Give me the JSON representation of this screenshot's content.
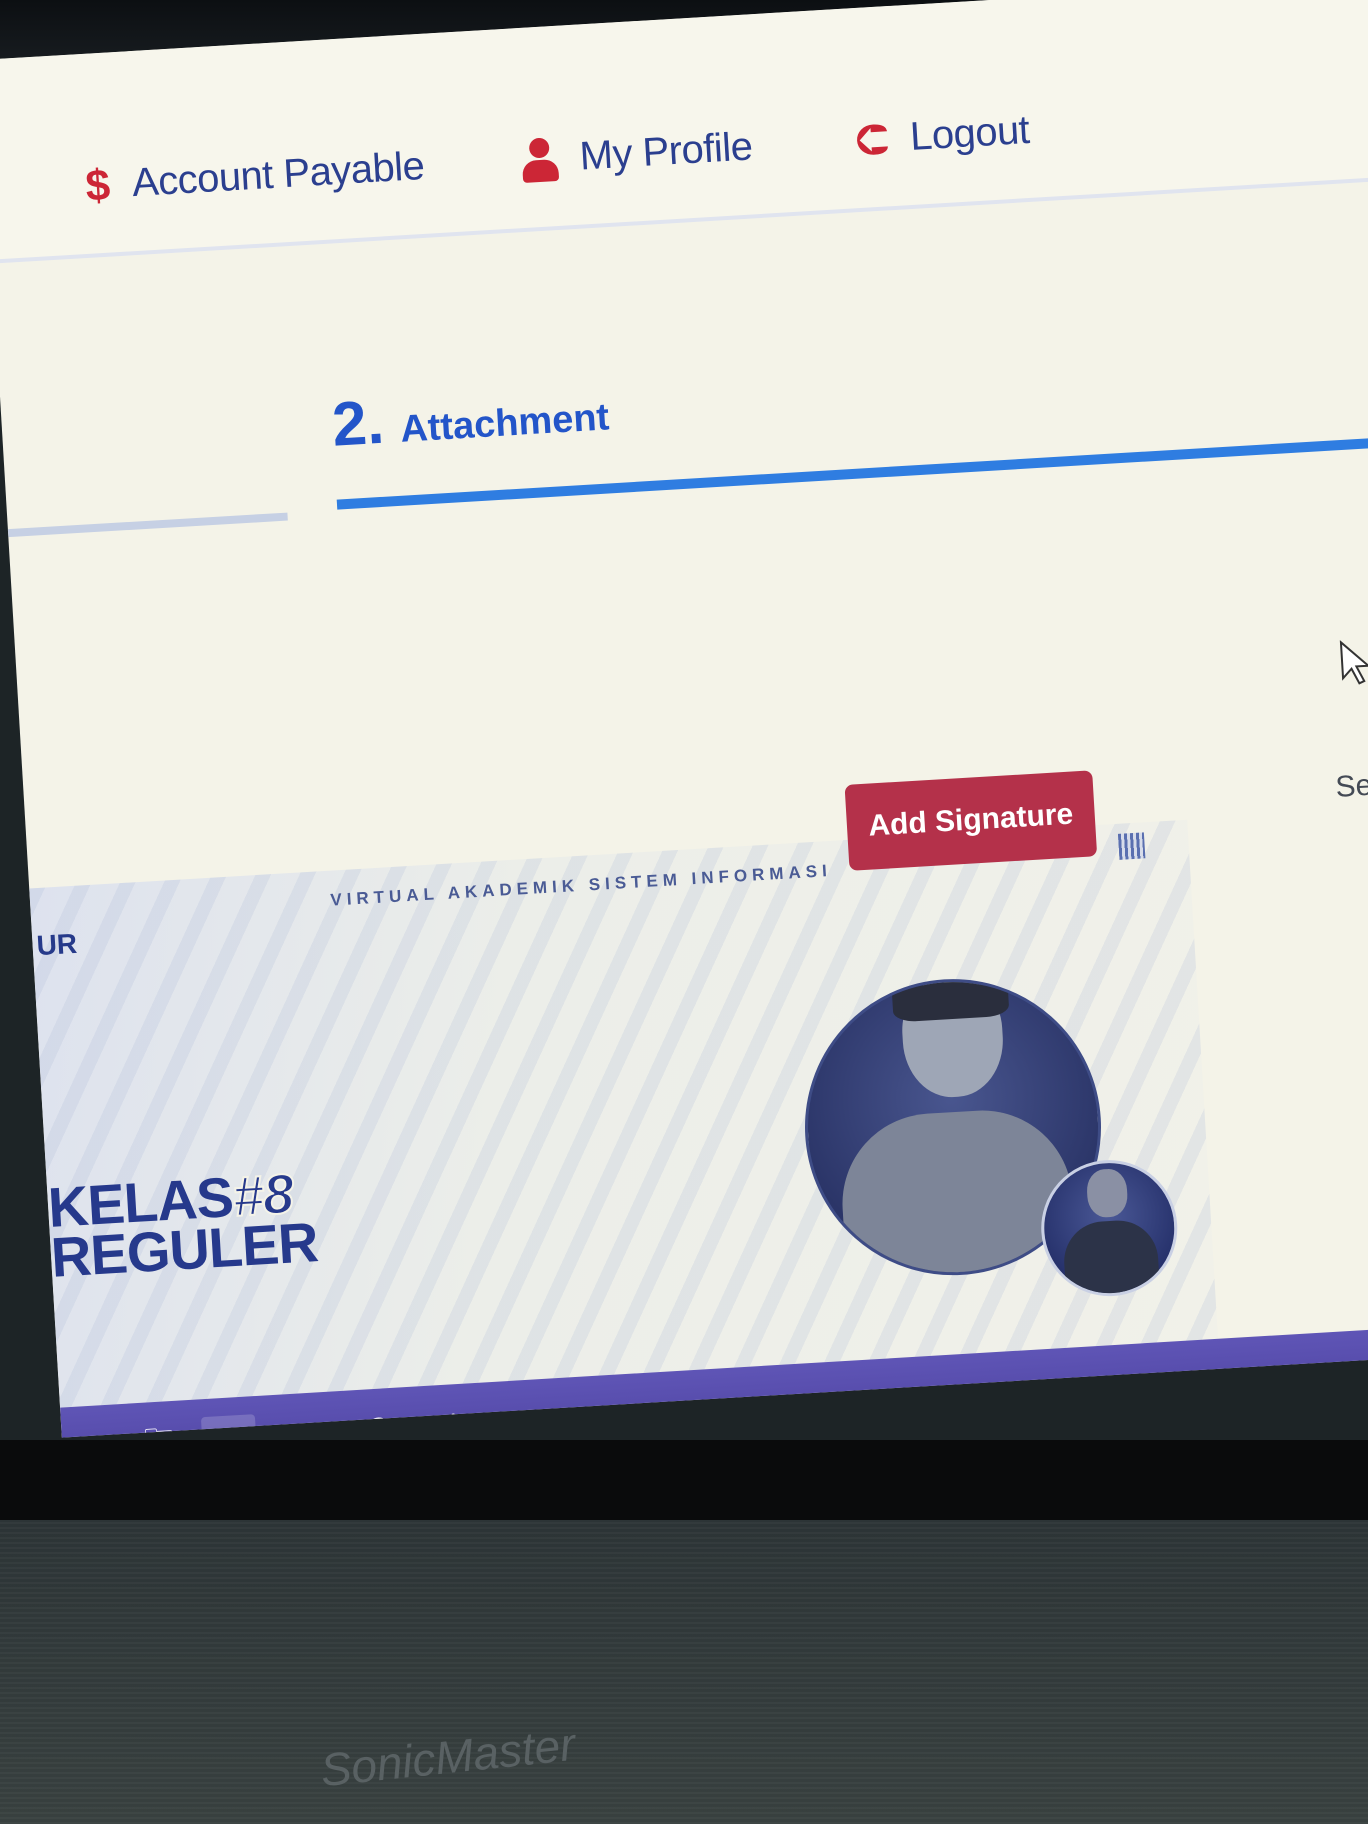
{
  "nav": {
    "account_payable": {
      "icon": "dollar-icon",
      "glyph": "$",
      "label": "Account Payable"
    },
    "my_profile": {
      "icon": "user-icon",
      "label": "My Profile"
    },
    "logout": {
      "icon": "logout-icon",
      "glyph": "⮈",
      "label": "Logout"
    }
  },
  "step": {
    "number": "2.",
    "label": "Attachment"
  },
  "sender_label": "Sender",
  "attachment": {
    "caption": "VIRTUAL AKADEMIK SISTEM INFORMASI",
    "corner_text": "UR",
    "title_line1": "KELAS",
    "title_hash": "#8",
    "title_line2": "REGULER"
  },
  "add_signature_label": "Add Signature",
  "taskbar": [
    {
      "name": "file-explorer-icon",
      "glyph": "🗀"
    },
    {
      "name": "chrome-icon",
      "glyph": "◉"
    },
    {
      "name": "notes-icon",
      "glyph": "▤"
    },
    {
      "name": "whatsapp-icon",
      "glyph": "✆"
    },
    {
      "name": "settings-icon",
      "glyph": "⚙"
    },
    {
      "name": "document-icon",
      "glyph": "▯"
    },
    {
      "name": "sticky-notes-icon",
      "glyph": "◧"
    },
    {
      "name": "terminal-icon",
      "glyph": "▭"
    },
    {
      "name": "photos-icon",
      "glyph": "▣"
    },
    {
      "name": "excel-icon",
      "glyph": "▦"
    }
  ],
  "laptop_brand": "SonicMaster",
  "colors": {
    "accent_blue": "#2f7de1",
    "nav_icon_red": "#cc2636",
    "button_red": "#b4314a",
    "taskbar_purple": "#5f55b6"
  }
}
